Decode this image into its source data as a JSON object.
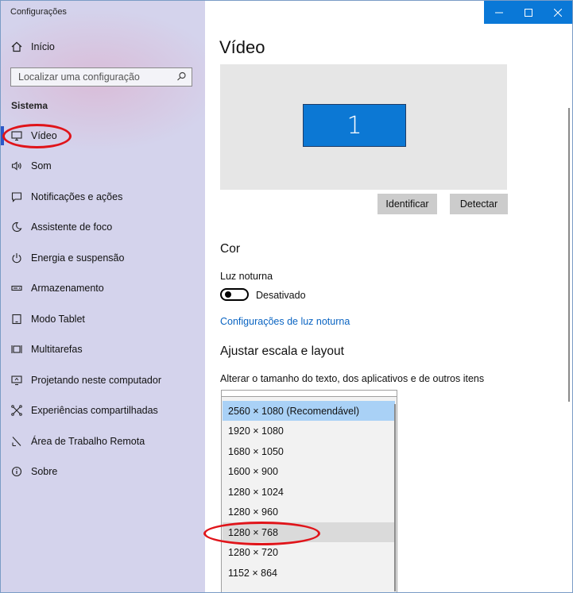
{
  "window": {
    "title": "Configurações",
    "controls": {
      "minimize_icon": "minimize-icon",
      "maximize_icon": "maximize-icon",
      "close_icon": "close-icon"
    }
  },
  "sidebar": {
    "home_label": "Início",
    "search_placeholder": "Localizar uma configuração",
    "section_title": "Sistema",
    "items": [
      {
        "label": "Vídeo",
        "icon": "monitor-icon",
        "active": true
      },
      {
        "label": "Som",
        "icon": "speaker-icon"
      },
      {
        "label": "Notificações e ações",
        "icon": "notification-icon"
      },
      {
        "label": "Assistente de foco",
        "icon": "moon-icon"
      },
      {
        "label": "Energia e suspensão",
        "icon": "power-icon"
      },
      {
        "label": "Armazenamento",
        "icon": "storage-icon"
      },
      {
        "label": "Modo Tablet",
        "icon": "tablet-icon"
      },
      {
        "label": "Multitarefas",
        "icon": "multitask-icon"
      },
      {
        "label": "Projetando neste computador",
        "icon": "project-icon"
      },
      {
        "label": "Experiências compartilhadas",
        "icon": "shared-icon"
      },
      {
        "label": "Área de Trabalho Remota",
        "icon": "remote-desktop-icon"
      },
      {
        "label": "Sobre",
        "icon": "info-icon"
      }
    ]
  },
  "main": {
    "page_title": "Vídeo",
    "monitor_number": "1",
    "identify_label": "Identificar",
    "detect_label": "Detectar",
    "color_heading": "Cor",
    "night_light_label": "Luz noturna",
    "night_light_state": "Desativado",
    "night_light_link": "Configurações de luz noturna",
    "scale_heading": "Ajustar escala e layout",
    "scale_description": "Alterar o tamanho do texto, dos aplicativos e de outros itens",
    "resolution_options": [
      "2560 × 1080 (Recomendável)",
      "1920 × 1080",
      "1680 × 1050",
      "1600 × 900",
      "1280 × 1024",
      "1280 × 960",
      "1280 × 768",
      "1280 × 720",
      "1152 × 864"
    ]
  },
  "colors": {
    "accent": "#0078d7",
    "annotation": "#e0141a",
    "selected": "#a9d1f6"
  }
}
